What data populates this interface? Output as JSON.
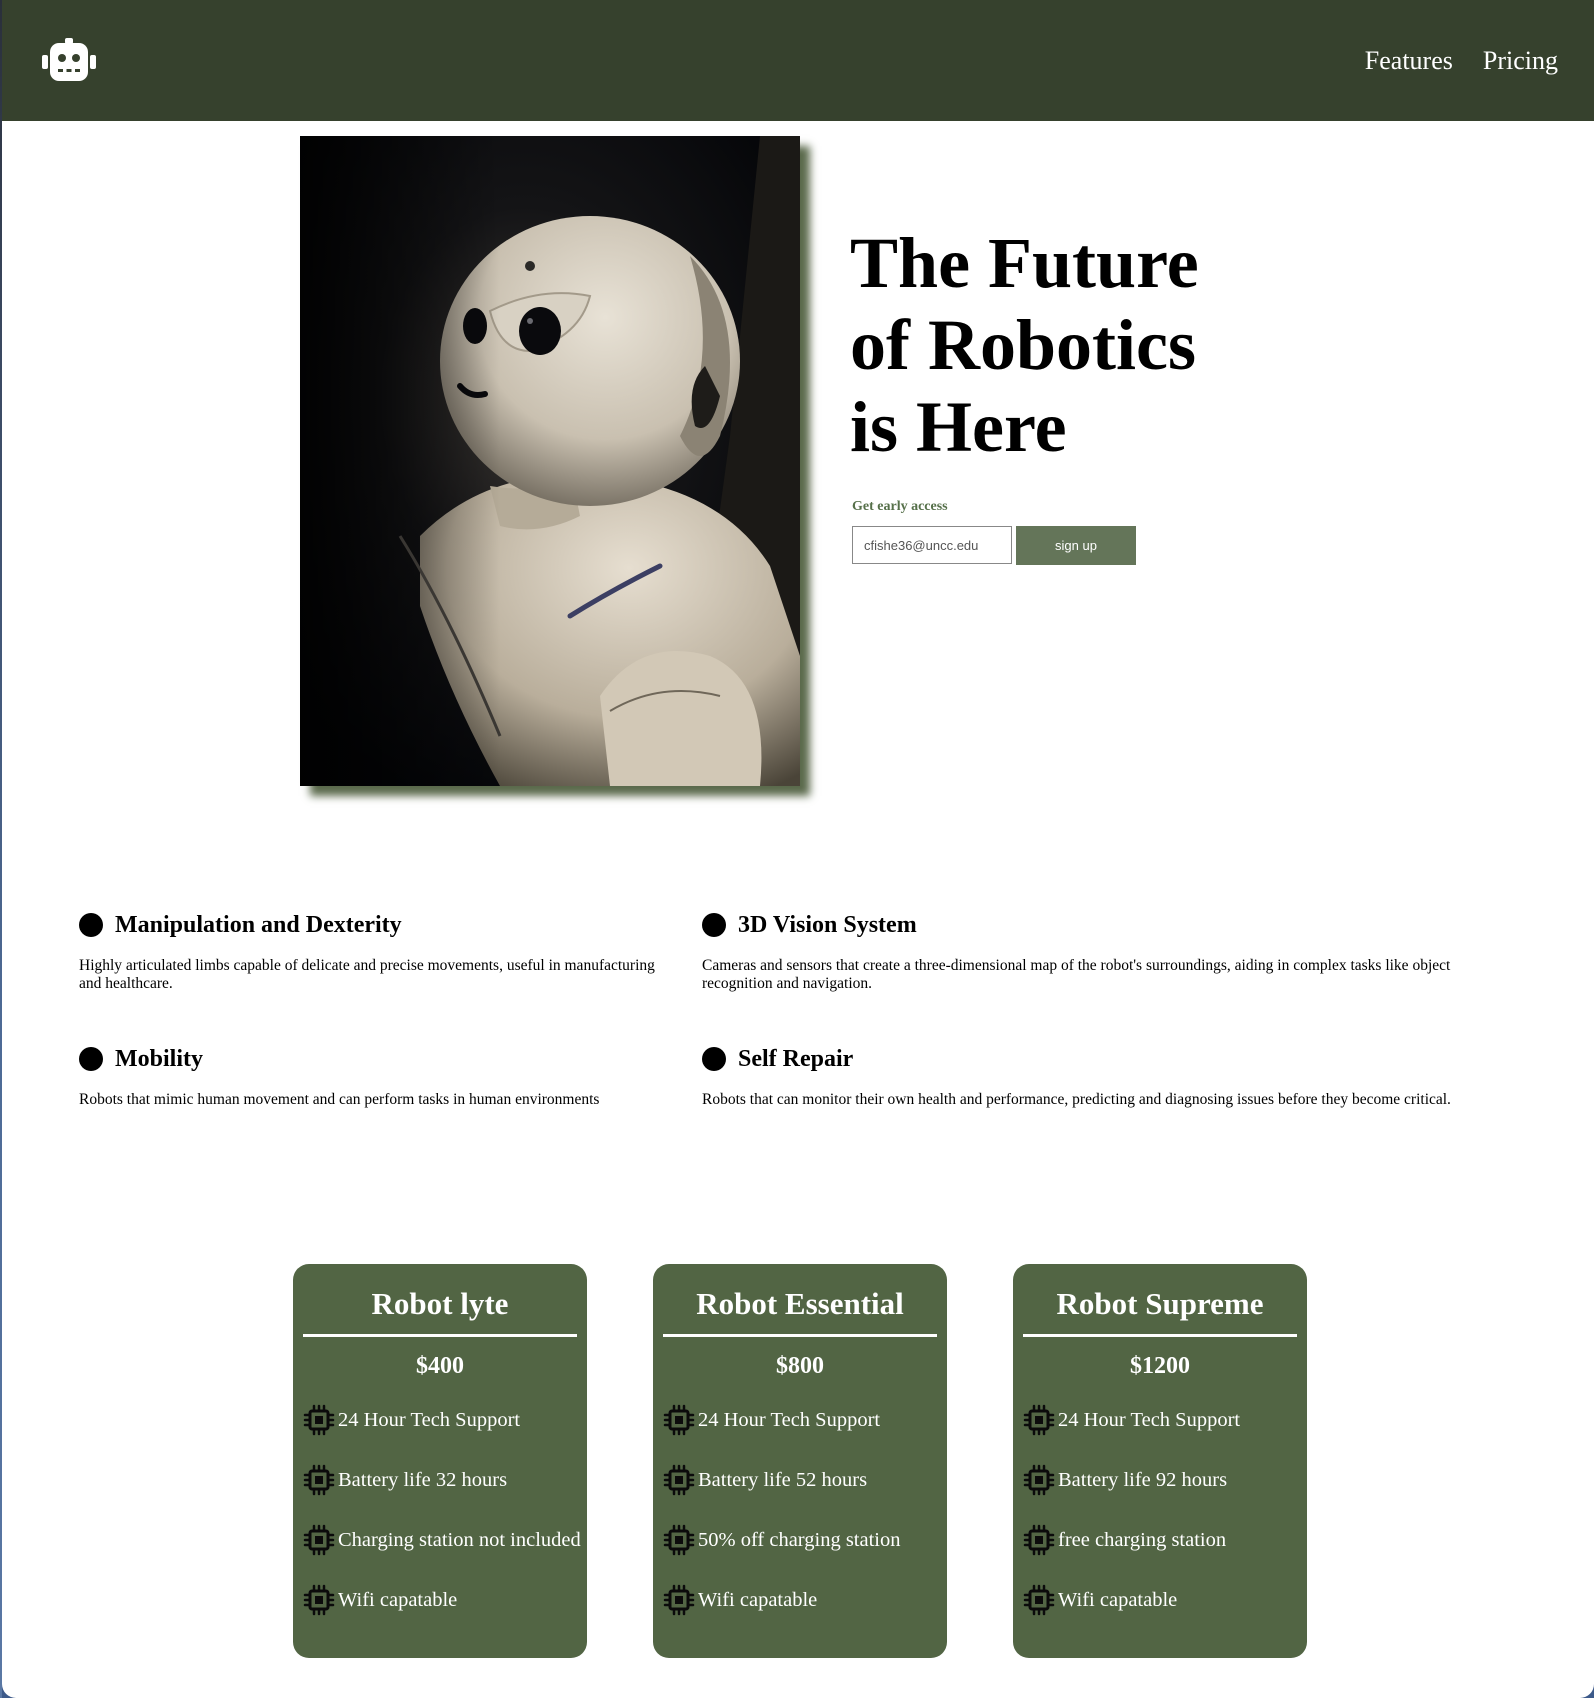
{
  "header": {
    "logo_icon": "robot-icon",
    "nav": [
      "Features",
      "Pricing"
    ],
    "background": "#36412d"
  },
  "hero": {
    "image_alt": "white humanoid robot",
    "title_lines": [
      "The Future",
      "of Robotics",
      "is Here"
    ],
    "early_access_label": "Get early access",
    "email_value": "cfishe36@uncc.edu",
    "signup_label": "sign up",
    "accent": "#647559"
  },
  "features": [
    {
      "title": "Manipulation and Dexterity",
      "desc": "Highly articulated limbs capable of delicate and precise movements, useful in manufacturing and healthcare."
    },
    {
      "title": "3D Vision System",
      "desc": "Cameras and sensors that create a three-dimensional map of the robot's surroundings, aiding in complex tasks like object recognition and navigation."
    },
    {
      "title": "Mobility",
      "desc": "Robots that mimic human movement and can perform tasks in human environments"
    },
    {
      "title": "Self Repair",
      "desc": "Robots that can monitor their own health and performance, predicting and diagnosing issues before they become critical."
    }
  ],
  "pricing": {
    "card_color": "#526544",
    "feature_icon": "chip-icon",
    "plans": [
      {
        "name": "Robot lyte",
        "price": "$400",
        "features": [
          "24 Hour Tech Support",
          "Battery life 32 hours",
          "Charging station not included",
          "Wifi capatable"
        ]
      },
      {
        "name": "Robot Essential",
        "price": "$800",
        "features": [
          "24 Hour Tech Support",
          "Battery life 52 hours",
          "50% off charging station",
          "Wifi capatable"
        ]
      },
      {
        "name": "Robot Supreme",
        "price": "$1200",
        "features": [
          "24 Hour Tech Support",
          "Battery life 92 hours",
          "free charging station",
          "Wifi capatable"
        ]
      }
    ]
  }
}
